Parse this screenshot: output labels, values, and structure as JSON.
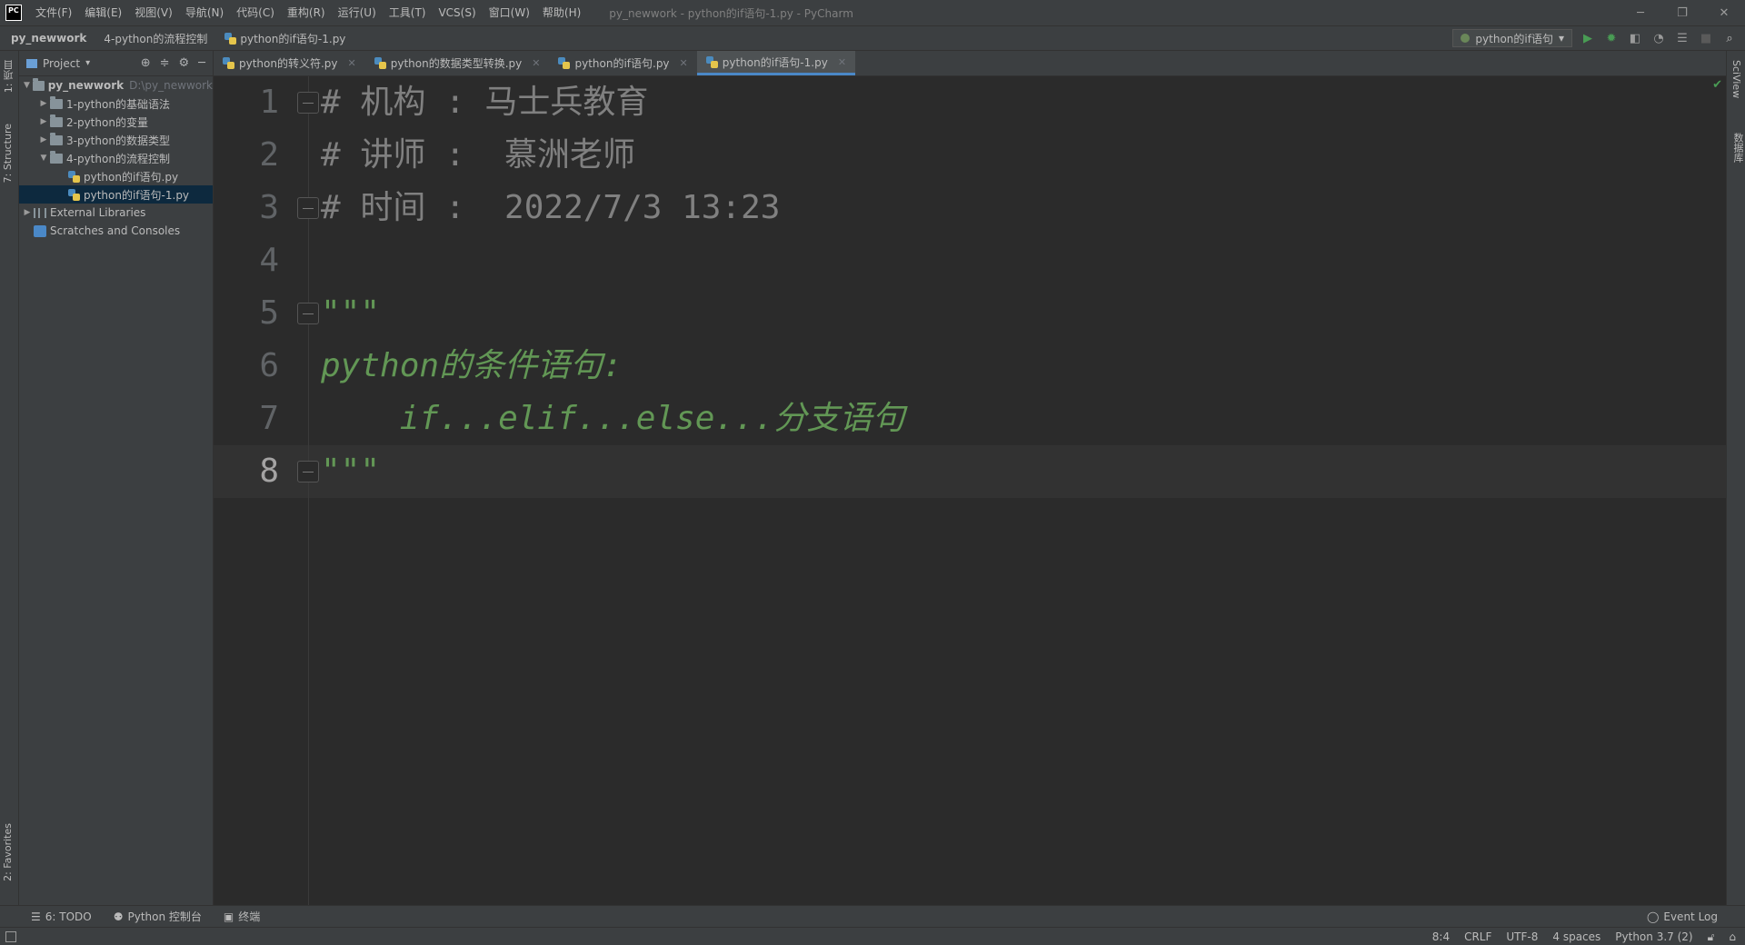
{
  "app": {
    "logo": "PC",
    "window_title": "py_newwork - python的if语句-1.py - PyCharm",
    "menu": [
      "文件(F)",
      "编辑(E)",
      "视图(V)",
      "导航(N)",
      "代码(C)",
      "重构(R)",
      "运行(U)",
      "工具(T)",
      "VCS(S)",
      "窗口(W)",
      "帮助(H)"
    ]
  },
  "navbar": {
    "crumbs": [
      "py_newwork",
      "4-python的流程控制",
      "python的if语句-1.py"
    ],
    "run_config": "python的if语句"
  },
  "left_strip": {
    "project_tab": "1: 项目",
    "structure_tab": "7: Structure",
    "favorites_tab": "2: Favorites"
  },
  "right_strip": {
    "sciview_tab": "SciView",
    "database_tab": "数据库"
  },
  "project_panel": {
    "title": "Project",
    "tree": [
      {
        "label": "py_newwork",
        "path": "D:\\py_newwork",
        "level": 0,
        "type": "folder",
        "expanded": true
      },
      {
        "label": "1-python的基础语法",
        "level": 1,
        "type": "folder"
      },
      {
        "label": "2-python的变量",
        "level": 1,
        "type": "folder"
      },
      {
        "label": "3-python的数据类型",
        "level": 1,
        "type": "folder"
      },
      {
        "label": "4-python的流程控制",
        "level": 1,
        "type": "folder",
        "expanded": true
      },
      {
        "label": "python的if语句.py",
        "level": 2,
        "type": "python-file"
      },
      {
        "label": "python的if语句-1.py",
        "level": 2,
        "type": "python-file",
        "selected": true
      },
      {
        "label": "External Libraries",
        "level": 0,
        "type": "library"
      },
      {
        "label": "Scratches and Consoles",
        "level": 0,
        "type": "scratch"
      }
    ]
  },
  "editor_tabs": [
    {
      "label": "python的转义符.py",
      "active": false
    },
    {
      "label": "python的数据类型转换.py",
      "active": false
    },
    {
      "label": "python的if语句.py",
      "active": false
    },
    {
      "label": "python的if语句-1.py",
      "active": true
    }
  ],
  "editor": {
    "current_line": 8,
    "lines": [
      {
        "no": "1",
        "text": "# 机构 : 马士兵教育",
        "style": "comment"
      },
      {
        "no": "2",
        "text": "# 讲师 :  慕洲老师",
        "style": "comment"
      },
      {
        "no": "3",
        "text": "# 时间 :  2022/7/3 13:23",
        "style": "comment"
      },
      {
        "no": "4",
        "text": "",
        "style": "comment"
      },
      {
        "no": "5",
        "text": "\"\"\"",
        "style": "doc"
      },
      {
        "no": "6",
        "text": "python的条件语句:",
        "style": "doc"
      },
      {
        "no": "7",
        "text": "    if...elif...else...分支语句",
        "style": "doc"
      },
      {
        "no": "8",
        "text": "\"\"\"",
        "style": "doc"
      }
    ]
  },
  "bottom_tools": {
    "todo": "6: TODO",
    "python_console": "Python 控制台",
    "terminal": "终端",
    "event_log": "Event Log"
  },
  "status": {
    "position": "8:4",
    "line_sep": "CRLF",
    "encoding": "UTF-8",
    "indent": "4 spaces",
    "interpreter": "Python 3.7 (2)"
  },
  "colors": {
    "accent": "#4a88c7",
    "comment": "#808080",
    "docstring": "#629755",
    "run": "#499c54"
  }
}
